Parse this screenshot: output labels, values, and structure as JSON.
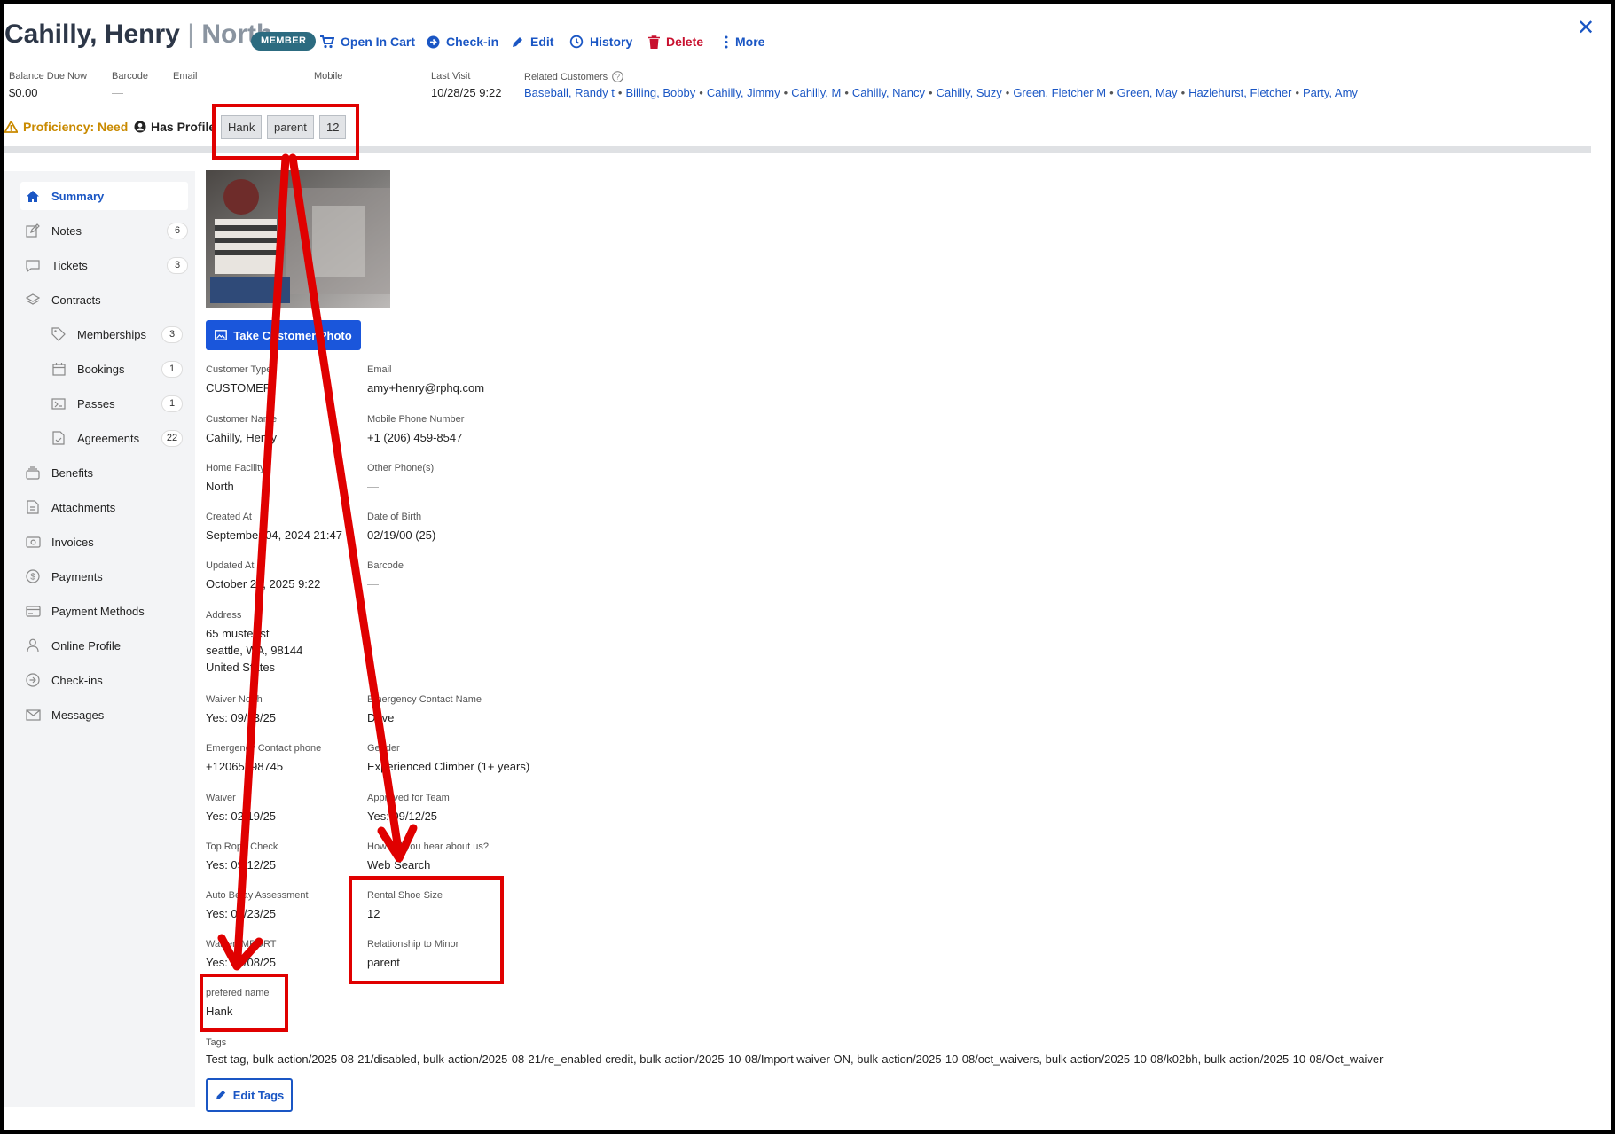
{
  "header": {
    "name": "Cahilly, Henry",
    "separator": "|",
    "facility": "North",
    "badge": "MEMBER",
    "actions": {
      "open_in_cart": "Open In Cart",
      "check_in": "Check-in",
      "edit": "Edit",
      "history": "History",
      "delete": "Delete",
      "more": "More"
    },
    "close": "✕"
  },
  "meta": {
    "balance_label": "Balance Due Now",
    "balance_value": "$0.00",
    "barcode_label": "Barcode",
    "barcode_value": "—",
    "email_label": "Email",
    "mobile_label": "Mobile",
    "last_visit_label": "Last Visit",
    "last_visit_value": "10/28/25 9:22",
    "related_label": "Related Customers",
    "related": [
      "Baseball, Randy t",
      "Billing, Bobby",
      "Cahilly, Jimmy",
      "Cahilly, M",
      "Cahilly, Nancy",
      "Cahilly, Suzy",
      "Green, Fletcher M",
      "Green, May",
      "Hazlehurst, Fletcher",
      "Party, Amy"
    ]
  },
  "status": {
    "proficiency": "Proficiency: Need",
    "has_profile": "Has Profile",
    "chips": [
      "Hank",
      "parent",
      "12"
    ]
  },
  "sidebar": {
    "items": [
      {
        "label": "Summary",
        "icon": "home-icon",
        "count": ""
      },
      {
        "label": "Notes",
        "icon": "pencil-square-icon",
        "count": "6"
      },
      {
        "label": "Tickets",
        "icon": "chat-bubble-icon",
        "count": "3"
      },
      {
        "label": "Contracts",
        "icon": "layers-icon",
        "count": ""
      },
      {
        "label": "Memberships",
        "icon": "tag-icon",
        "count": "3"
      },
      {
        "label": "Bookings",
        "icon": "calendar-icon",
        "count": "1"
      },
      {
        "label": "Passes",
        "icon": "ticket-icon",
        "count": "1"
      },
      {
        "label": "Agreements",
        "icon": "document-check-icon",
        "count": "22"
      },
      {
        "label": "Benefits",
        "icon": "stack-icon",
        "count": ""
      },
      {
        "label": "Attachments",
        "icon": "file-icon",
        "count": ""
      },
      {
        "label": "Invoices",
        "icon": "money-icon",
        "count": ""
      },
      {
        "label": "Payments",
        "icon": "dollar-circle-icon",
        "count": ""
      },
      {
        "label": "Payment Methods",
        "icon": "credit-card-icon",
        "count": ""
      },
      {
        "label": "Online Profile",
        "icon": "person-icon",
        "count": ""
      },
      {
        "label": "Check-ins",
        "icon": "arrow-circle-icon",
        "count": ""
      },
      {
        "label": "Messages",
        "icon": "envelope-icon",
        "count": ""
      }
    ]
  },
  "content": {
    "photo_button": "Take Customer Photo",
    "left_fields": [
      {
        "label": "Customer Type",
        "value": "CUSTOMER"
      },
      {
        "label": "Customer Name",
        "value": "Cahilly, Henry"
      },
      {
        "label": "Home Facility",
        "value": "North"
      },
      {
        "label": "Created At",
        "value": "September 04, 2024 21:47"
      },
      {
        "label": "Updated At",
        "value": "October 28, 2025 9:22"
      },
      {
        "label": "Address",
        "value": "65 muster st",
        "value2": "seattle, WA, 98144",
        "value3": "United States"
      },
      {
        "label": "Waiver North",
        "value": "Yes: 09/13/25"
      },
      {
        "label": "Emergency Contact phone",
        "value": "+12065598745"
      },
      {
        "label": "Waiver",
        "value": "Yes: 02/19/25"
      },
      {
        "label": "Top Rope Check",
        "value": "Yes: 09/12/25"
      },
      {
        "label": "Auto Belay Assessment",
        "value": "Yes: 09/23/25"
      },
      {
        "label": "Waiver IMPORT",
        "value": "Yes: 10/08/25"
      },
      {
        "label": "prefered name",
        "value": "Hank"
      }
    ],
    "right_fields": [
      {
        "label": "Email",
        "value": "amy+henry@rphq.com"
      },
      {
        "label": "Mobile Phone Number",
        "value": "+1 (206) 459-8547"
      },
      {
        "label": "Other Phone(s)",
        "value": "—"
      },
      {
        "label": "Date of Birth",
        "value": "02/19/00 (25)"
      },
      {
        "label": "Barcode",
        "value": "—"
      },
      {
        "label": "Emergency Contact Name",
        "value": "Dave"
      },
      {
        "label": "Gender",
        "value": "Experienced Climber (1+ years)"
      },
      {
        "label": "Approved for Team",
        "value": "Yes: 09/12/25"
      },
      {
        "label": "How did you hear about us?",
        "value": "Web Search"
      },
      {
        "label": "Rental Shoe Size",
        "value": "12"
      },
      {
        "label": "Relationship to Minor",
        "value": "parent"
      }
    ],
    "tags_label": "Tags",
    "tags_value": "Test tag, bulk-action/2025-08-21/disabled, bulk-action/2025-08-21/re_enabled credit, bulk-action/2025-10-08/Import waiver ON, bulk-action/2025-10-08/oct_waivers, bulk-action/2025-10-08/k02bh, bulk-action/2025-10-08/Oct_waiver",
    "edit_tags": "Edit Tags"
  },
  "colors": {
    "accent": "#1a56c4",
    "danger": "#c8102e",
    "warning": "#c98a00",
    "badge": "#2c6b80",
    "annotation": "#e00000"
  }
}
